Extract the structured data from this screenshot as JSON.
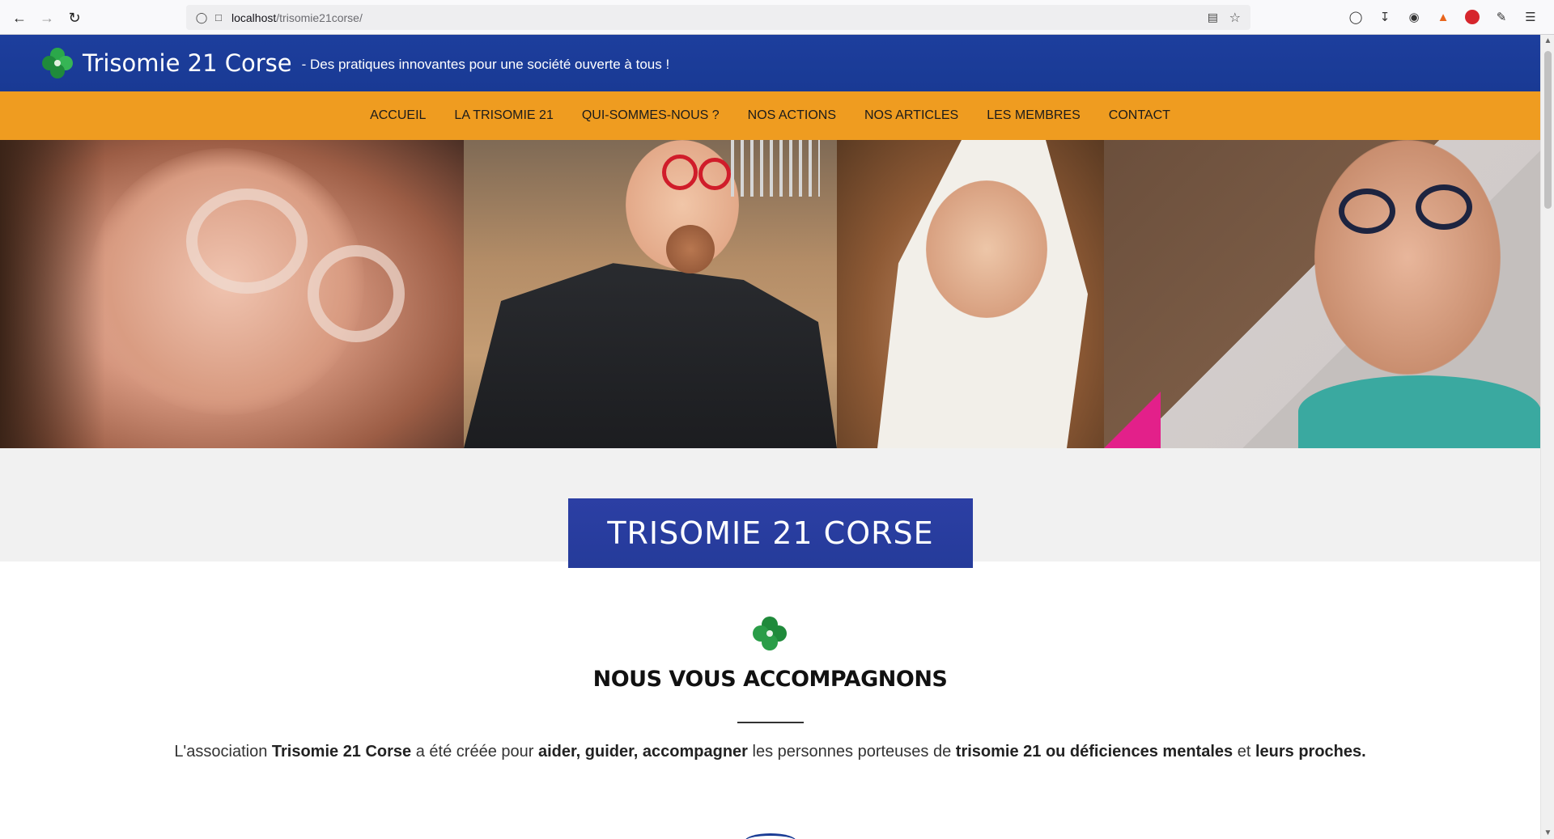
{
  "browser": {
    "url_host": "localhost",
    "url_path": "/trisomie21corse/"
  },
  "site": {
    "brand": "Trisomie 21 Corse",
    "tagline": "- Des pratiques innovantes pour une société ouverte à tous !",
    "menu": [
      {
        "label": "ACCUEIL"
      },
      {
        "label": "LA TRISOMIE 21"
      },
      {
        "label": "QUI-SOMMES-NOUS ?"
      },
      {
        "label": "NOS ACTIONS"
      },
      {
        "label": "NOS ARTICLES"
      },
      {
        "label": "LES MEMBRES"
      },
      {
        "label": "CONTACT"
      }
    ],
    "banner_title": "TRISOMIE 21 CORSE",
    "section_title": "NOUS VOUS ACCOMPAGNONS",
    "intro": {
      "t1": "L'association ",
      "b1": "Trisomie 21 Corse",
      "t2": " a été créée pour ",
      "b2": "aider, guider, accompagner",
      "t3": " les personnes porteuses de ",
      "b3": "trisomie 21 ou déficiences mentales",
      "t4": " et ",
      "b4": "leurs proches."
    }
  },
  "colors": {
    "header_blue": "#1d3e9d",
    "menu_orange": "#ef9c20",
    "clover_green": "#1f8a3b"
  }
}
